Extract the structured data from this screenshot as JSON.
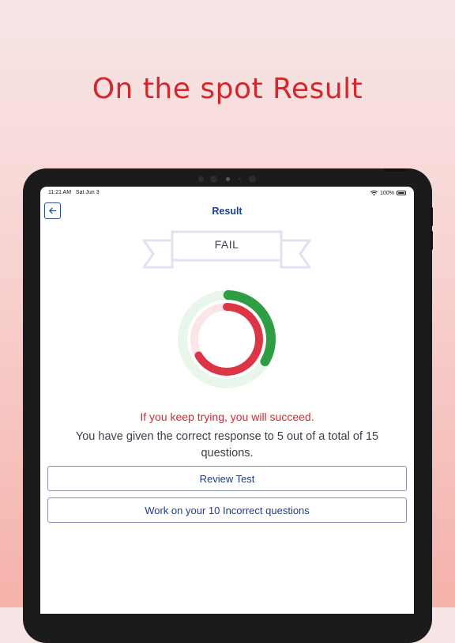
{
  "promo": {
    "title": "On the spot Result"
  },
  "status_bar": {
    "time": "11:21 AM",
    "date": "Sat Jun 3",
    "battery": "100%"
  },
  "header": {
    "back_icon": "arrow-left-icon",
    "title": "Result"
  },
  "result": {
    "status": "FAIL",
    "correct": 5,
    "incorrect": 10,
    "total": 15,
    "encouragement": "If you keep trying, you will succeed.",
    "summary": "You have given the correct response to 5 out of a total of 15 questions."
  },
  "actions": {
    "review_label": "Review Test",
    "incorrect_label": "Work on your 10 Incorrect questions"
  },
  "colors": {
    "promo_title": "#d1282d",
    "accent_blue": "#1d3f8f",
    "correct_green": "#2e9d44",
    "incorrect_red": "#dc3545",
    "ribbon": "#dde3f2"
  }
}
